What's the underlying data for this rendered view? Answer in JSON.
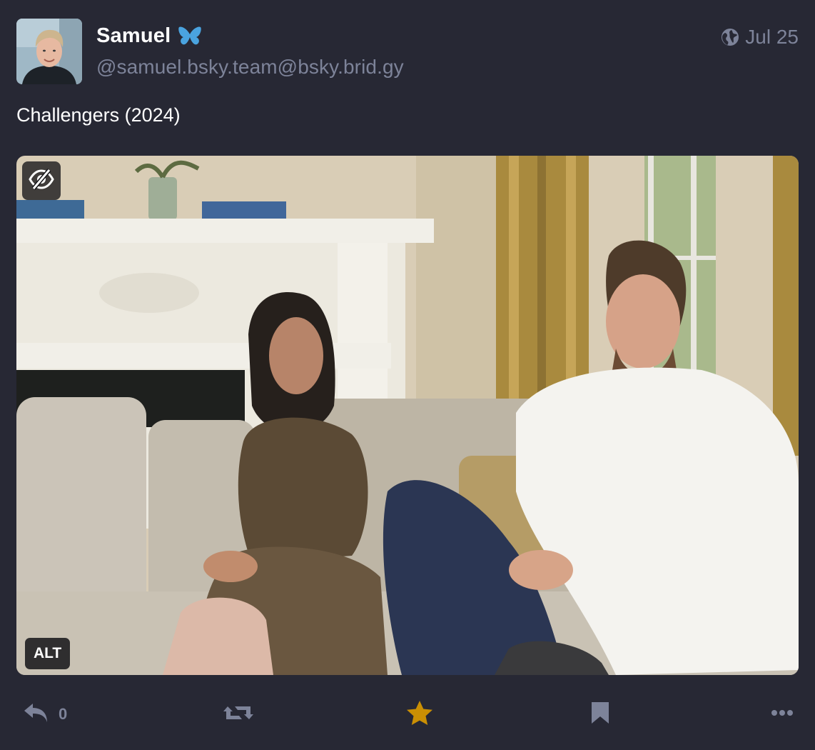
{
  "post": {
    "display_name": "Samuel",
    "handle": "@samuel.bsky.team@bsky.brid.gy",
    "date": "Jul 25",
    "text": "Challengers (2024)",
    "media": {
      "alt_badge": "ALT"
    },
    "actions": {
      "reply_count": "0",
      "favourited": true
    }
  },
  "colors": {
    "background": "#272834",
    "secondary_text": "#7d8399",
    "favourite_star": "#ca8f04",
    "butterfly": "#4aa3df"
  },
  "icons": {
    "visibility": "globe-icon",
    "hide_media": "eye-slash-icon",
    "reply": "reply-icon",
    "boost": "retweet-icon",
    "favourite": "star-icon",
    "bookmark": "bookmark-icon",
    "more": "ellipsis-icon",
    "bridge_badge": "butterfly-icon"
  }
}
